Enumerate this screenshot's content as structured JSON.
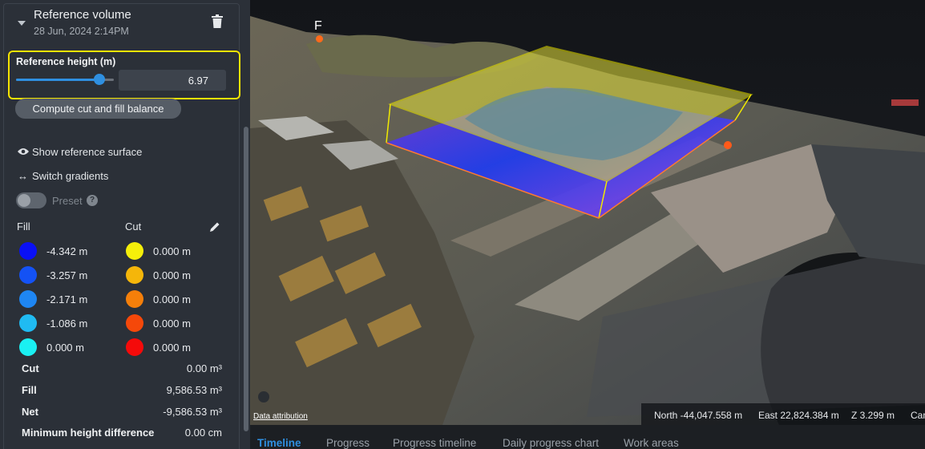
{
  "panel": {
    "title": "Reference volume",
    "subtitle": "28 Jun, 2024 2:14PM",
    "reference_height_label": "Reference height (m)",
    "reference_height_value": "6.97",
    "slider_level_fraction": 0.85,
    "compute_button": "Compute cut and fill balance",
    "show_reference_surface": "Show reference surface",
    "switch_gradients": "Switch gradients",
    "preset_label": "Preset",
    "preset_help": "?",
    "fill_header": "Fill",
    "cut_header": "Cut",
    "fill_legend": [
      {
        "value": "-4.342 m",
        "color": "#0a10f5"
      },
      {
        "value": "-3.257 m",
        "color": "#1452f5"
      },
      {
        "value": "-2.171 m",
        "color": "#1e86f3"
      },
      {
        "value": "-1.086 m",
        "color": "#20bbf2"
      },
      {
        "value": "0.000 m",
        "color": "#1af0f2"
      }
    ],
    "cut_legend": [
      {
        "value": "0.000 m",
        "color": "#f5ef0a"
      },
      {
        "value": "0.000 m",
        "color": "#f5b60a"
      },
      {
        "value": "0.000 m",
        "color": "#f57f0a"
      },
      {
        "value": "0.000 m",
        "color": "#f5480a"
      },
      {
        "value": "0.000 m",
        "color": "#f50a0a"
      }
    ],
    "stats": [
      {
        "label": "Cut",
        "value": "0.00 m³"
      },
      {
        "label": "Fill",
        "value": "9,586.53 m³"
      },
      {
        "label": "Net",
        "value": "-9,586.53 m³"
      },
      {
        "label": "Minimum height difference",
        "value": "0.00 cm"
      }
    ]
  },
  "view": {
    "marker_label": "F",
    "data_attribution": "Data attribution",
    "coords": {
      "north": "North -44,047.558 m",
      "east": "East 22,824.384 m",
      "z": "Z 3.299 m",
      "cam": "Cam"
    }
  },
  "tabs": [
    "Timeline",
    "Progress",
    "Progress timeline",
    "Daily progress chart",
    "Work areas"
  ],
  "active_tab": "Timeline",
  "colors": {
    "accent": "#2f8fe0",
    "highlight_border": "#f4e400",
    "panel_bg": "#2b3038"
  }
}
